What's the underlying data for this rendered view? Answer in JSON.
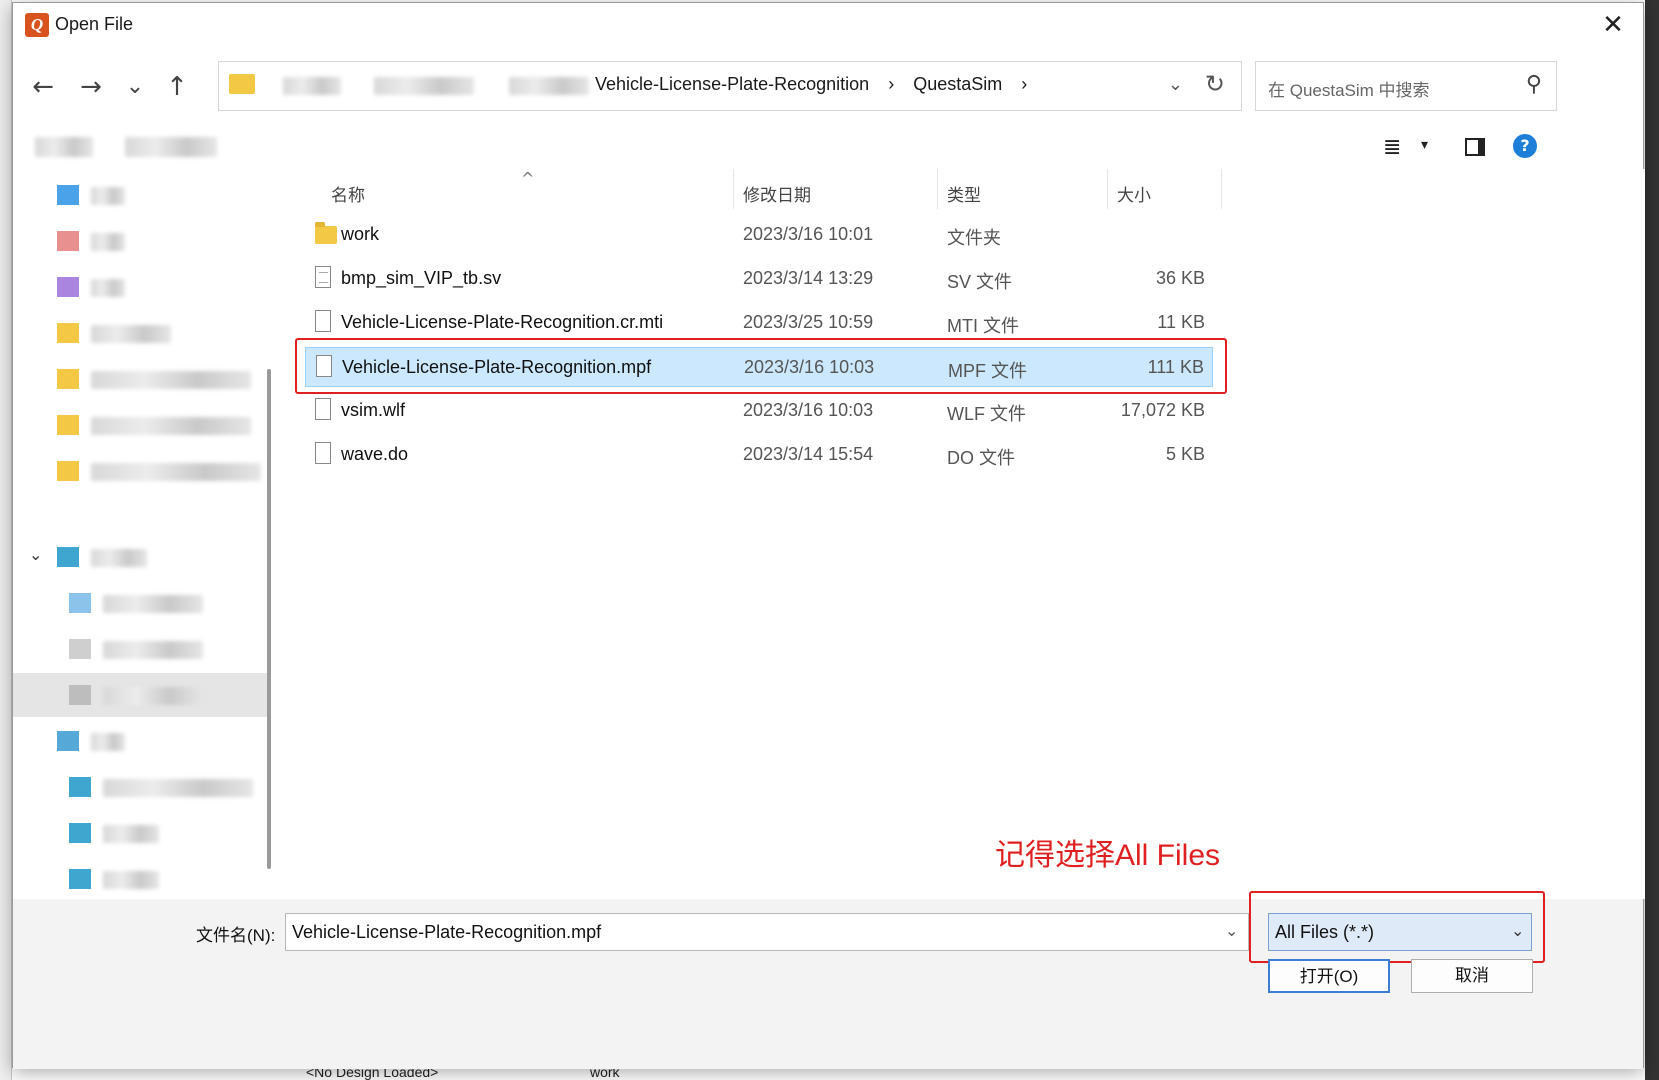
{
  "background": {
    "status_left": "<No Design Loaded>",
    "status_right": "work"
  },
  "dialog": {
    "title": "Open File",
    "close_icon": "close-icon"
  },
  "nav": {
    "back_icon": "←",
    "forward_icon": "→",
    "recent_icon": "⌄",
    "up_icon": "↑",
    "path": [
      "Vehicle-License-Plate-Recognition",
      "›",
      "QuestaSim",
      "›"
    ],
    "dropdown_icon": "⌄",
    "refresh_icon": "↻",
    "search_placeholder": "在 QuestaSim 中搜索",
    "search_icon": "⚲"
  },
  "toolbar": {
    "view_icon": "≣",
    "view_dd_icon": "▾",
    "help_label": "?"
  },
  "columns": {
    "name": "名称",
    "date": "修改日期",
    "type": "类型",
    "size": "大小",
    "sort_icon": "^"
  },
  "files": [
    {
      "name": "work",
      "date": "2023/3/16 10:01",
      "type": "文件夹",
      "size": "",
      "icon": "folder-icon"
    },
    {
      "name": "bmp_sim_VIP_tb.sv",
      "date": "2023/3/14 13:29",
      "type": "SV 文件",
      "size": "36 KB",
      "icon": "text-file-icon"
    },
    {
      "name": "Vehicle-License-Plate-Recognition.cr.mti",
      "date": "2023/3/25 10:59",
      "type": "MTI 文件",
      "size": "11 KB",
      "icon": "file-icon"
    },
    {
      "name": "Vehicle-License-Plate-Recognition.mpf",
      "date": "2023/3/16 10:03",
      "type": "MPF 文件",
      "size": "111 KB",
      "icon": "file-icon"
    },
    {
      "name": "vsim.wlf",
      "date": "2023/3/16 10:03",
      "type": "WLF 文件",
      "size": "17,072 KB",
      "icon": "file-icon"
    },
    {
      "name": "wave.do",
      "date": "2023/3/14 15:54",
      "type": "DO 文件",
      "size": "5 KB",
      "icon": "file-icon"
    }
  ],
  "annotation": {
    "text": "记得选择All Files",
    "color": "#e02020"
  },
  "bottom": {
    "filename_label": "文件名(N):",
    "filename_value": "Vehicle-License-Plate-Recognition.mpf",
    "filetype_value": "All Files (*.*)",
    "dd_icon": "⌄",
    "open_label": "打开(O)",
    "cancel_label": "取消"
  },
  "colors": {
    "selection_bg": "#cce8ff",
    "accent": "#3b7ed4",
    "highlight_border": "#e02020"
  }
}
